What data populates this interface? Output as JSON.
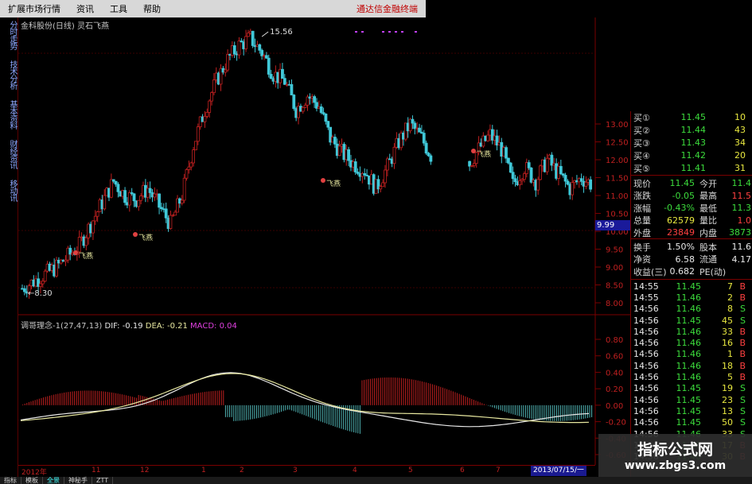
{
  "menubar": {
    "items": [
      "扩展市场行情",
      "资讯",
      "工具",
      "帮助"
    ],
    "brand": "通达信金融终端"
  },
  "left_tabs": [
    "分时走势",
    "技术分析",
    "基本资料",
    "财经资讯",
    "移动讯"
  ],
  "stock": {
    "title": "金科股份(日线)",
    "sub": "灵石飞燕"
  },
  "chart_data": {
    "type": "candlestick",
    "title": "金科股份(日线)",
    "price_axis": [
      "13.00",
      "12.50",
      "12.00",
      "11.50",
      "11.00",
      "10.50",
      "10.00",
      "9.50",
      "9.00",
      "8.50",
      "8.00"
    ],
    "high_label": "15.56",
    "low_label": "8.30",
    "signal_label": "飞燕",
    "cursor_price": "9.99",
    "macd_axis": [
      "0.80",
      "0.60",
      "0.40",
      "0.20",
      "0.00",
      "-0.20",
      "-0.40",
      "-0.60"
    ],
    "months": [
      "2012年",
      "11",
      "12",
      "1",
      "2",
      "3",
      "4",
      "5",
      "6",
      "7"
    ],
    "cursor_date": "2013/07/15/一",
    "close_series": [
      8.4,
      8.6,
      8.8,
      9.0,
      9.3,
      9.6,
      10.2,
      10.8,
      11.4,
      11.0,
      10.9,
      11.2,
      10.7,
      10.2,
      11.0,
      12.4,
      13.4,
      14.2,
      14.8,
      15.2,
      15.4,
      15.0,
      14.4,
      14.2,
      13.4,
      13.8,
      13.5,
      12.6,
      12.2,
      11.9,
      11.7,
      11.2,
      11.8,
      12.5,
      13.0,
      12.6,
      12.0,
      11.8,
      12.2,
      11.8,
      12.3,
      12.7,
      12.3,
      11.3,
      11.8,
      11.4,
      12.0,
      11.6,
      11.2,
      11.5,
      11.3
    ],
    "macd": {
      "name": "调哥理念-1",
      "params": "(27,47,13)",
      "dif_label": "DIF: -0.19",
      "dea_label": "DEA: -0.21",
      "macd_label": "MACD: 0.04"
    }
  },
  "quote": {
    "bids": [
      {
        "label": "买①",
        "price": "11.45",
        "vol": "10"
      },
      {
        "label": "买②",
        "price": "11.44",
        "vol": "43"
      },
      {
        "label": "买③",
        "price": "11.43",
        "vol": "34"
      },
      {
        "label": "买④",
        "price": "11.42",
        "vol": "20"
      },
      {
        "label": "买⑤",
        "price": "11.41",
        "vol": "31"
      }
    ],
    "stats": [
      {
        "l1": "现价",
        "v1": "11.45",
        "c1": "green",
        "l2": "今开",
        "v2": "11.4",
        "c2": "green"
      },
      {
        "l1": "涨跌",
        "v1": "-0.05",
        "c1": "green",
        "l2": "最高",
        "v2": "11.5",
        "c2": "red"
      },
      {
        "l1": "涨幅",
        "v1": "-0.43%",
        "c1": "green",
        "l2": "最低",
        "v2": "11.3",
        "c2": "green"
      },
      {
        "l1": "总量",
        "v1": "62579",
        "c1": "yellow",
        "l2": "量比",
        "v2": "1.0",
        "c2": "red"
      },
      {
        "l1": "外盘",
        "v1": "23849",
        "c1": "red",
        "l2": "内盘",
        "v2": "3873",
        "c2": "green"
      }
    ],
    "stats2": [
      {
        "l1": "换手",
        "v1": "1.50%",
        "c1": "white",
        "l2": "股本",
        "v2": "11.6",
        "c2": "white"
      },
      {
        "l1": "净资",
        "v1": "6.58",
        "c1": "white",
        "l2": "流通",
        "v2": "4.17",
        "c2": "white"
      },
      {
        "l1": "收益(三)",
        "v1": "0.682",
        "c1": "white",
        "l2": "PE(动)",
        "v2": "",
        "c2": "white"
      }
    ],
    "ticks": [
      {
        "t": "14:55",
        "p": "11.45",
        "v": "7",
        "d": "B"
      },
      {
        "t": "14:55",
        "p": "11.46",
        "v": "2",
        "d": "B"
      },
      {
        "t": "14:56",
        "p": "11.46",
        "v": "8",
        "d": "S"
      },
      {
        "t": "14:56",
        "p": "11.45",
        "v": "45",
        "d": "S"
      },
      {
        "t": "14:56",
        "p": "11.46",
        "v": "33",
        "d": "B"
      },
      {
        "t": "14:56",
        "p": "11.46",
        "v": "16",
        "d": "B"
      },
      {
        "t": "14:56",
        "p": "11.46",
        "v": "1",
        "d": "B"
      },
      {
        "t": "14:56",
        "p": "11.46",
        "v": "18",
        "d": "B"
      },
      {
        "t": "14:56",
        "p": "11.46",
        "v": "5",
        "d": "B"
      },
      {
        "t": "14:56",
        "p": "11.45",
        "v": "19",
        "d": "S"
      },
      {
        "t": "14:56",
        "p": "11.45",
        "v": "23",
        "d": "S"
      },
      {
        "t": "14:56",
        "p": "11.45",
        "v": "13",
        "d": "S"
      },
      {
        "t": "14:56",
        "p": "11.45",
        "v": "50",
        "d": "S"
      },
      {
        "t": "14:56",
        "p": "11.46",
        "v": "33",
        "d": "S"
      },
      {
        "t": "14:56",
        "p": "11.46",
        "v": "17",
        "d": "B"
      },
      {
        "t": "14:56",
        "p": "11.46",
        "v": "30",
        "d": "B"
      }
    ]
  },
  "bottom_tabs": [
    "指标",
    "模板",
    "全景",
    "神秘手",
    "ZTT"
  ],
  "watermark": {
    "title": "指标公式网",
    "url": "www.zbgs3.com"
  },
  "colors": {
    "up": "#c02020",
    "down": "#40c8d8",
    "grid": "#7a0000",
    "dif": "#e8e8e8",
    "dea": "#e8e8a0"
  }
}
